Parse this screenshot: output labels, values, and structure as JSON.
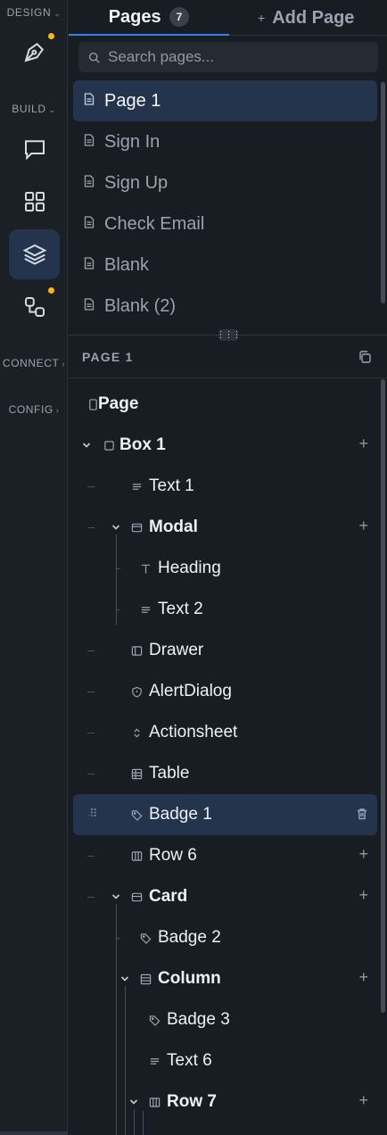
{
  "rail": {
    "design_label": "DESIGN",
    "build_label": "BUILD",
    "connect_label": "CONNECT",
    "config_label": "CONFIG",
    "buttons": [
      {
        "name": "pen-tool-icon",
        "dot": true
      },
      {
        "name": "chat-bubble-icon",
        "dot": false
      },
      {
        "name": "grid-icon",
        "dot": false
      },
      {
        "name": "layers-icon",
        "dot": false,
        "active": true
      },
      {
        "name": "workflow-icon",
        "dot": true
      }
    ],
    "accent_dot_color": "#f5b81c"
  },
  "tabs": {
    "pages_label": "Pages",
    "pages_count": "7",
    "add_plus": "+",
    "add_page_label": "Add Page"
  },
  "search": {
    "placeholder": "Search pages..."
  },
  "pages": [
    "Page 1",
    "Sign In",
    "Sign Up",
    "Check Email",
    "Blank",
    "Blank (2)"
  ],
  "layers": {
    "title": "PAGE 1",
    "tree": [
      {
        "label": "Page",
        "icon": "page-icon",
        "bold": true
      },
      {
        "label": "Box 1",
        "icon": "box-icon",
        "bold": true,
        "expanded": true,
        "addable": true
      },
      {
        "label": "Text 1",
        "icon": "text-icon"
      },
      {
        "label": "Modal",
        "icon": "modal-icon",
        "bold": true,
        "expanded": true,
        "addable": true
      },
      {
        "label": "Heading",
        "icon": "heading-icon"
      },
      {
        "label": "Text 2",
        "icon": "text-icon"
      },
      {
        "label": "Drawer",
        "icon": "drawer-icon"
      },
      {
        "label": "AlertDialog",
        "icon": "shield-icon"
      },
      {
        "label": "Actionsheet",
        "icon": "sort-icon"
      },
      {
        "label": "Table",
        "icon": "table-icon"
      },
      {
        "label": "Badge 1",
        "icon": "tag-icon",
        "selected": true
      },
      {
        "label": "Row 6",
        "icon": "row-icon",
        "addable": true
      },
      {
        "label": "Card",
        "icon": "card-icon",
        "bold": true,
        "expanded": true,
        "addable": true
      },
      {
        "label": "Badge 2",
        "icon": "tag-icon"
      },
      {
        "label": "Column",
        "icon": "column-icon",
        "bold": true,
        "expanded": true,
        "addable": true
      },
      {
        "label": "Badge 3",
        "icon": "tag-icon"
      },
      {
        "label": "Text 6",
        "icon": "text-icon"
      },
      {
        "label": "Row 7",
        "icon": "row-icon",
        "bold": true,
        "expanded": true,
        "addable": true
      }
    ]
  },
  "colors": {
    "accent": "#3d7ee8",
    "selected_bg": "#24344d",
    "panel_bg": "#181c23"
  }
}
